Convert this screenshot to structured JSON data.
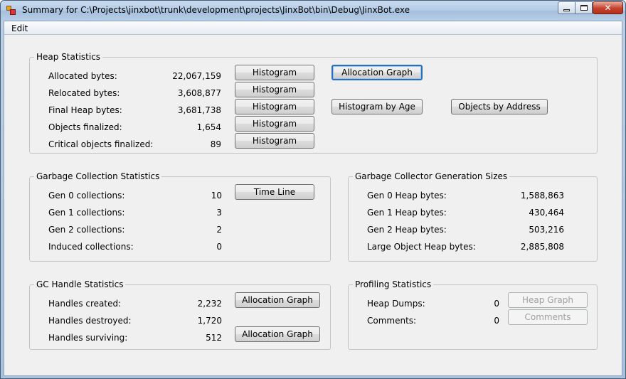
{
  "window": {
    "title": "Summary for C:\\Projects\\jinxbot\\trunk\\development\\projects\\JinxBot\\bin\\Debug\\JinxBot.exe",
    "controls": {
      "minimize_icon": "minimize-icon",
      "maximize_icon": "maximize-icon",
      "close_icon": "close-icon"
    }
  },
  "menu": {
    "items": [
      "Edit"
    ]
  },
  "heap_statistics": {
    "title": "Heap Statistics",
    "rows": [
      {
        "label": "Allocated bytes:",
        "value": "22,067,159",
        "button": "Histogram"
      },
      {
        "label": "Relocated bytes:",
        "value": "3,608,877",
        "button": "Histogram"
      },
      {
        "label": "Final Heap bytes:",
        "value": "3,681,738",
        "button": "Histogram"
      },
      {
        "label": "Objects finalized:",
        "value": "1,654",
        "button": "Histogram"
      },
      {
        "label": "Critical objects finalized:",
        "value": "89",
        "button": "Histogram"
      }
    ],
    "allocation_graph_label": "Allocation Graph",
    "histogram_by_age_label": "Histogram by Age",
    "objects_by_address_label": "Objects by Address"
  },
  "gc_statistics": {
    "title": "Garbage Collection Statistics",
    "rows": [
      {
        "label": "Gen 0 collections:",
        "value": "10"
      },
      {
        "label": "Gen 1 collections:",
        "value": "3"
      },
      {
        "label": "Gen 2 collections:",
        "value": "2"
      },
      {
        "label": "Induced collections:",
        "value": "0"
      }
    ],
    "time_line_label": "Time Line"
  },
  "generation_sizes": {
    "title": "Garbage Collector Generation Sizes",
    "rows": [
      {
        "label": "Gen 0 Heap bytes:",
        "value": "1,588,863"
      },
      {
        "label": "Gen 1 Heap bytes:",
        "value": "430,464"
      },
      {
        "label": "Gen 2 Heap bytes:",
        "value": "503,216"
      },
      {
        "label": "Large Object Heap bytes:",
        "value": "2,885,808"
      }
    ]
  },
  "handle_statistics": {
    "title": "GC Handle Statistics",
    "rows": [
      {
        "label": "Handles created:",
        "value": "2,232"
      },
      {
        "label": "Handles destroyed:",
        "value": "1,720"
      },
      {
        "label": "Handles surviving:",
        "value": "512"
      }
    ],
    "allocation_graph_created_label": "Allocation Graph",
    "allocation_graph_surviving_label": "Allocation Graph"
  },
  "profiling_statistics": {
    "title": "Profiling Statistics",
    "rows": [
      {
        "label": "Heap Dumps:",
        "value": "0"
      },
      {
        "label": "Comments:",
        "value": "0"
      }
    ],
    "heap_graph_label": "Heap Graph",
    "comments_label": "Comments"
  }
}
